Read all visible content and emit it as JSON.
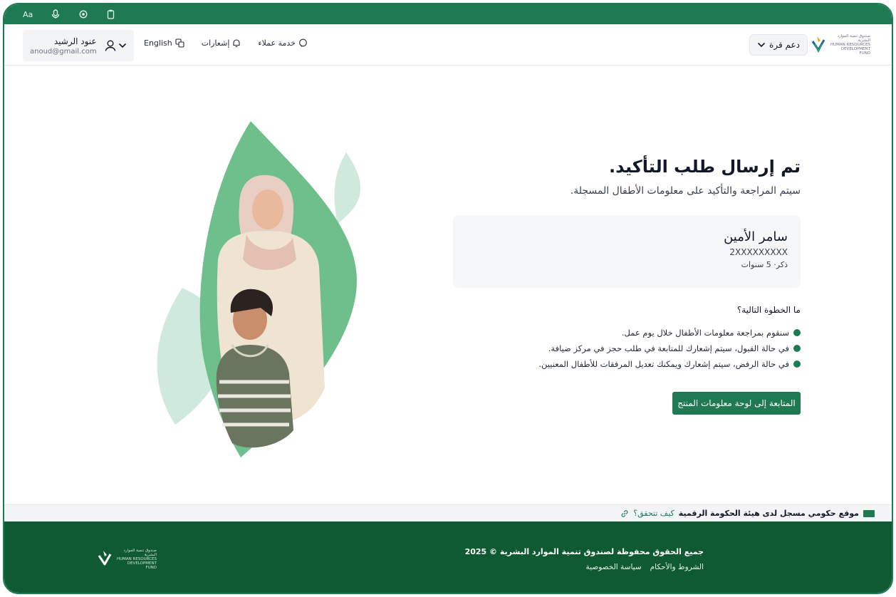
{
  "accessibility": {
    "font_size_label": "Aa"
  },
  "header": {
    "logo_text_ar": "صندوق تنمية الموارد البشرية",
    "logo_text_en": "HUMAN RESOURCES DEVELOPMENT FUND",
    "support_label": "دعم قرة",
    "language_label": "English",
    "notifications_label": "إشعارات",
    "customer_service_label": "خدمة عملاء",
    "user_name": "عنود الرشيد",
    "user_email": "anoud@gmail.com"
  },
  "main": {
    "title": "تم إرسال طلب التأكيد.",
    "subtitle": "سيتم المراجعة والتأكيد على معلومات الأطفال المسجلة.",
    "child": {
      "name": "سامر الأمين",
      "id": "2XXXXXXXXX",
      "meta": "ذكر· 5 سنوات"
    },
    "next_title": "ما الخطوة التالية؟",
    "steps": [
      "سنقوم بمراجعة معلومات الأطفال خلال يوم عمل.",
      "في حالة القبول، سيتم إشعارك للمتابعة في طلب حجز في مركز ضيافة.",
      "في حالة الرفض، سيتم إشعارك ويمكنك تعديل المرفقات للأطفال المعنيين."
    ],
    "cta_label": "المتابعة إلى لوحة معلومات المنتج"
  },
  "gov_bar": {
    "text": "موقع حكومي مسجل لدى هيئة الحكومة الرقمية",
    "link": "كيف تتحقق؟"
  },
  "footer": {
    "copyright": "جميع الحقوق محفوظة لصندوق تنمية الموارد البشرية © 2025",
    "links": [
      "الشروط والأحكام",
      "سياسة الخصوصية"
    ]
  },
  "colors": {
    "brand_green": "#1f7a52",
    "footer_green": "#0f5a32",
    "leaf_light": "#cfe9dc",
    "leaf_mid": "#6fbf8c"
  }
}
